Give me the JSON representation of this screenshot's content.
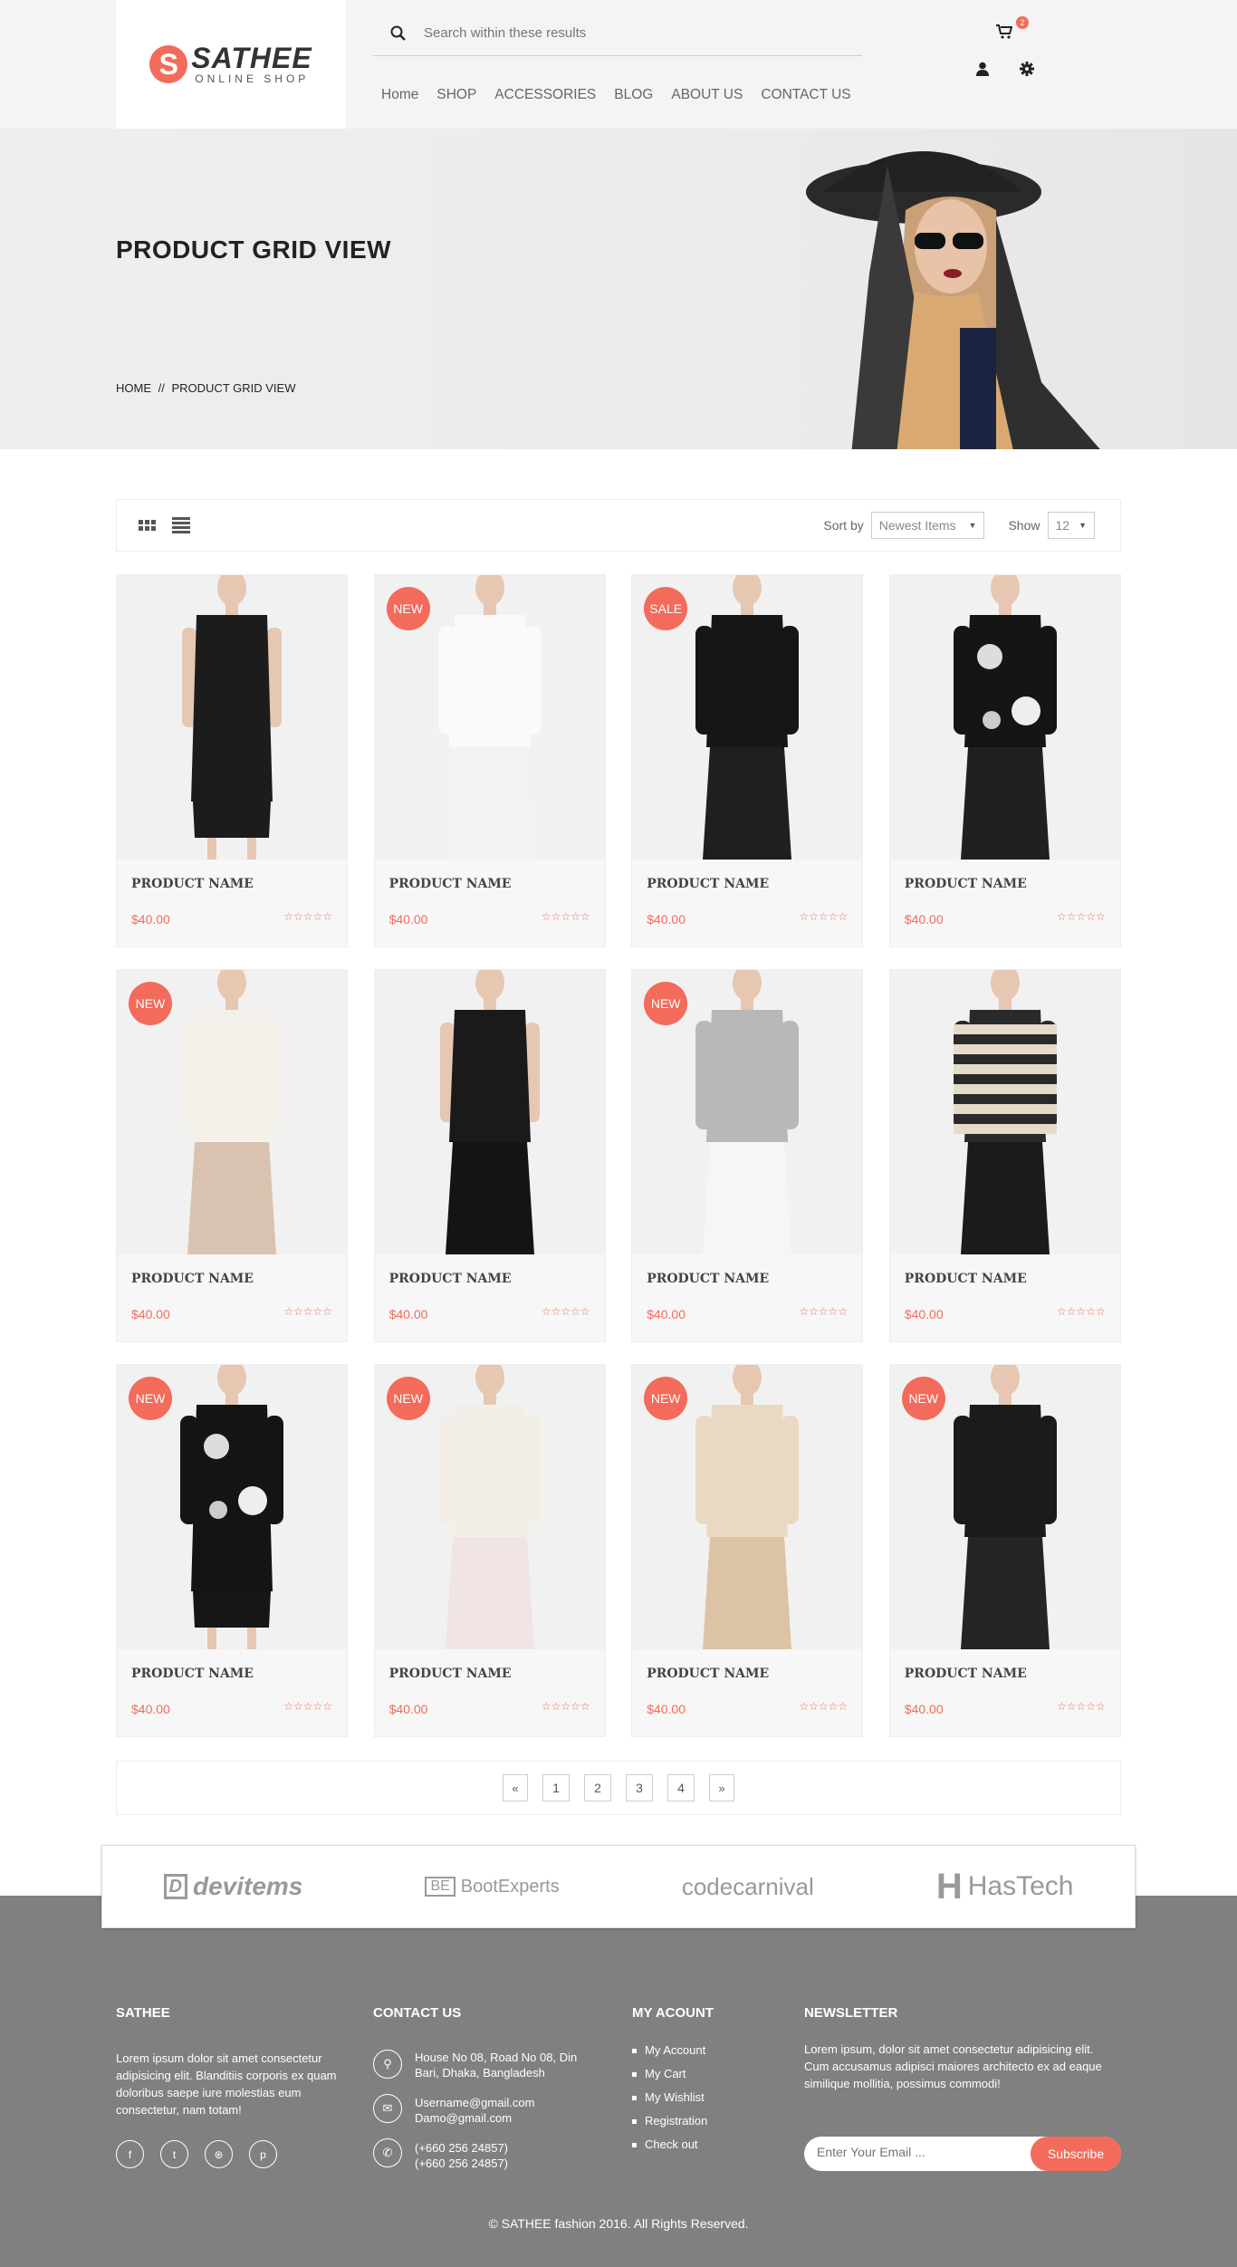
{
  "header": {
    "logo_letter": "S",
    "logo_main": "SATHEE",
    "logo_sub": "ONLINE SHOP",
    "search_placeholder": "Search within these results",
    "cart_count": "2",
    "nav": [
      "Home",
      "SHOP",
      "ACCESSORIES",
      "BLOG",
      "ABOUT US",
      "CONTACT US"
    ]
  },
  "hero": {
    "title": "PRODUCT GRID VIEW",
    "breadcrumb": [
      "HOME",
      "//",
      "PRODUCT GRID VIEW"
    ]
  },
  "toolbar": {
    "sort_label": "Sort by",
    "sort_value": "Newest Items",
    "show_label": "Show",
    "show_value": "12"
  },
  "products": [
    {
      "badge": "",
      "name": "PRODUCT NAME",
      "price": "$40.00",
      "rating": 0,
      "style": "black-dress"
    },
    {
      "badge": "NEW",
      "name": "PRODUCT NAME",
      "price": "$40.00",
      "rating": 0,
      "style": "white-suit"
    },
    {
      "badge": "SALE",
      "name": "PRODUCT NAME",
      "price": "$40.00",
      "rating": 0,
      "style": "black-top"
    },
    {
      "badge": "",
      "name": "PRODUCT NAME",
      "price": "$40.00",
      "rating": 0,
      "style": "floral-black"
    },
    {
      "badge": "NEW",
      "name": "PRODUCT NAME",
      "price": "$40.00",
      "rating": 0,
      "style": "cream-wrap"
    },
    {
      "badge": "",
      "name": "PRODUCT NAME",
      "price": "$40.00",
      "rating": 0,
      "style": "black-sleeveless"
    },
    {
      "badge": "NEW",
      "name": "PRODUCT NAME",
      "price": "$40.00",
      "rating": 0,
      "style": "grey-sweater"
    },
    {
      "badge": "",
      "name": "PRODUCT NAME",
      "price": "$40.00",
      "rating": 0,
      "style": "striped-tee"
    },
    {
      "badge": "NEW",
      "name": "PRODUCT NAME",
      "price": "$40.00",
      "rating": 0,
      "style": "floral-coat"
    },
    {
      "badge": "NEW",
      "name": "PRODUCT NAME",
      "price": "$40.00",
      "rating": 0,
      "style": "white-cardigan"
    },
    {
      "badge": "NEW",
      "name": "PRODUCT NAME",
      "price": "$40.00",
      "rating": 0,
      "style": "beige-sheer"
    },
    {
      "badge": "NEW",
      "name": "PRODUCT NAME",
      "price": "$40.00",
      "rating": 0,
      "style": "black-cardigan"
    }
  ],
  "pagination": [
    "«",
    "1",
    "2",
    "3",
    "4",
    "»"
  ],
  "brands": [
    "devitems",
    "BootExperts",
    "codecarnival",
    "HasTech"
  ],
  "footer": {
    "about_title": "SATHEE",
    "about_text": "Lorem ipsum dolor sit amet consectetur adipisicing elit. Blanditiis corporis ex quam doloribus saepe iure molestias eum consectetur, nam totam!",
    "contact_title": "CONTACT US",
    "address": "House No 08, Road No 08, Din Bari, Dhaka, Bangladesh",
    "email1": "Username@gmail.com",
    "email2": "Damo@gmail.com",
    "phone1": "(+660 256 24857)",
    "phone2": "(+660 256 24857)",
    "account_title": "MY ACOUNT",
    "account_links": [
      "My Account",
      "My Cart",
      "My Wishlist",
      "Registration",
      "Check out"
    ],
    "newsletter_title": "NEWSLETTER",
    "newsletter_text": "Lorem ipsum, dolor sit amet consectetur adipisicing elit. Cum accusamus adipisci maiores architecto ex ad eaque similique mollitia, possimus commodi!",
    "newsletter_placeholder": "Enter Your Email ...",
    "subscribe_label": "Subscribe",
    "copyright": "© SATHEE fashion 2016. All Rights Reserved."
  },
  "colors": {
    "accent": "#f26b5b",
    "footer_bg": "#808080"
  }
}
